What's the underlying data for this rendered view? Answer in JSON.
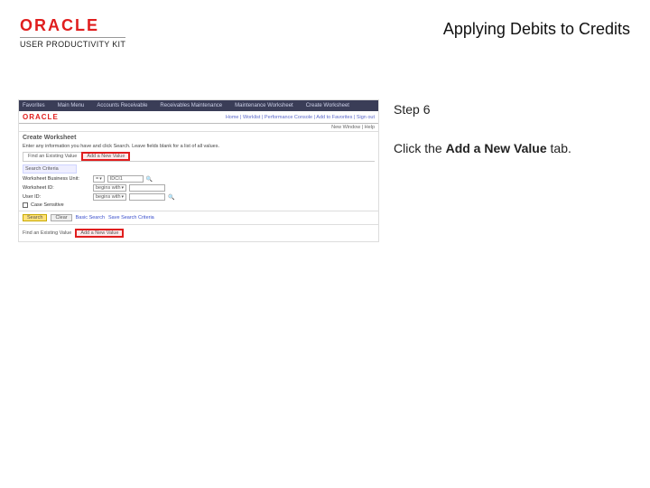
{
  "header": {
    "brand": "ORACLE",
    "brand_sub": "USER PRODUCTIVITY KIT",
    "title": "Applying Debits to Credits"
  },
  "instructions": {
    "step_label": "Step 6",
    "line_prefix": "Click the ",
    "line_bold": "Add a New Value",
    "line_suffix": " tab."
  },
  "screenshot": {
    "topbar": {
      "items": [
        "Favorites",
        "Main Menu",
        "Accounts Receivable",
        "Receivables Maintenance",
        "Maintenance Worksheet",
        "Create Worksheet"
      ]
    },
    "oracle_logo": "ORACLE",
    "oracle_links": "Home | Worklist | Performance Console | Add to Favorites | Sign out",
    "subbar": "New Window | Help",
    "section_title": "Create Worksheet",
    "section_desc": "Enter any information you have and click Search. Leave fields blank for a list of all values.",
    "tabs": {
      "find": "Find an Existing Value",
      "add": "Add a New Value"
    },
    "form_header": "Search Criteria",
    "fields": {
      "bu_label": "Worksheet Business Unit:",
      "bu_op": "=",
      "bu_val": "IDCI1",
      "ws_label": "Worksheet ID:",
      "ws_op": "begins with",
      "ws_val": "",
      "user_label": "User ID:",
      "user_op": "begins with",
      "user_val": "",
      "cs_label": "Case Sensitive"
    },
    "buttons": {
      "search": "Search",
      "clear": "Clear",
      "basic": "Basic Search",
      "save": "Save Search Criteria"
    },
    "footer_label": "Find an Existing Value",
    "footer_btn": "Add a New Value"
  }
}
